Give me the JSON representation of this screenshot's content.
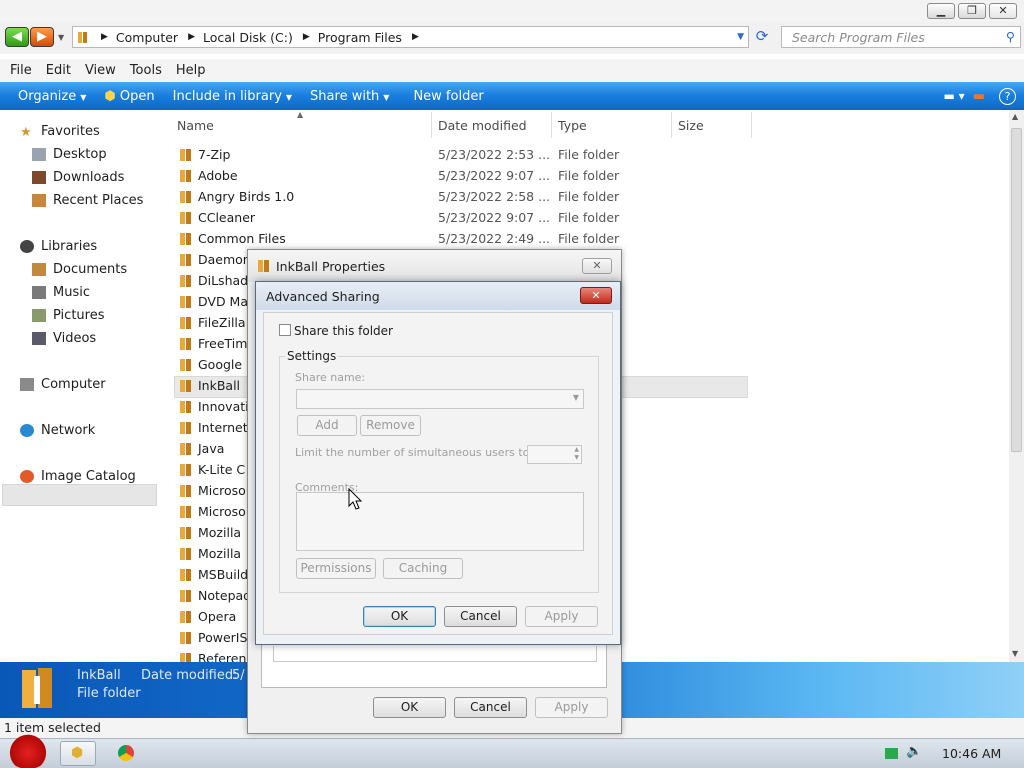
{
  "window": {
    "minimize": "▁",
    "maximize": "❐",
    "close": "✕"
  },
  "address": {
    "crumbs": [
      "Computer",
      "Local Disk (C:)",
      "Program Files"
    ],
    "search_placeholder": "Search Program Files"
  },
  "menu": [
    "File",
    "Edit",
    "View",
    "Tools",
    "Help"
  ],
  "toolbar": {
    "organize": "Organize",
    "open": "Open",
    "include_in_library": "Include in library",
    "share_with": "Share with",
    "new_folder": "New folder"
  },
  "nav": {
    "favorites": "Favorites",
    "desktop": "Desktop",
    "downloads": "Downloads",
    "recent_places": "Recent Places",
    "libraries": "Libraries",
    "documents": "Documents",
    "music": "Music",
    "pictures": "Pictures",
    "videos": "Videos",
    "computer": "Computer",
    "network": "Network",
    "image_catalog": "Image Catalog"
  },
  "columns": {
    "name": "Name",
    "date_modified": "Date modified",
    "type": "Type",
    "size": "Size"
  },
  "files": [
    {
      "name": "7-Zip",
      "date": "5/23/2022 2:53 ...",
      "type": "File folder"
    },
    {
      "name": "Adobe",
      "date": "5/23/2022 9:07 ...",
      "type": "File folder"
    },
    {
      "name": "Angry Birds 1.0",
      "date": "5/23/2022 2:58 ...",
      "type": "File folder"
    },
    {
      "name": "CCleaner",
      "date": "5/23/2022 9:07 ...",
      "type": "File folder"
    },
    {
      "name": "Common Files",
      "date": "5/23/2022 2:49 ...",
      "type": "File folder"
    },
    {
      "name": "Daemon",
      "date": "",
      "type": ""
    },
    {
      "name": "DiLshad",
      "date": "",
      "type": ""
    },
    {
      "name": "DVD Ma",
      "date": "",
      "type": ""
    },
    {
      "name": "FileZilla",
      "date": "",
      "type": ""
    },
    {
      "name": "FreeTim",
      "date": "",
      "type": ""
    },
    {
      "name": "Google",
      "date": "",
      "type": ""
    },
    {
      "name": "InkBall",
      "date": "",
      "type": ""
    },
    {
      "name": "Innovati",
      "date": "",
      "type": ""
    },
    {
      "name": "Internet",
      "date": "",
      "type": ""
    },
    {
      "name": "Java",
      "date": "",
      "type": ""
    },
    {
      "name": "K-Lite C",
      "date": "",
      "type": ""
    },
    {
      "name": "Microso",
      "date": "",
      "type": ""
    },
    {
      "name": "Microso",
      "date": "",
      "type": ""
    },
    {
      "name": "Mozilla",
      "date": "",
      "type": ""
    },
    {
      "name": "Mozilla",
      "date": "",
      "type": ""
    },
    {
      "name": "MSBuild",
      "date": "",
      "type": ""
    },
    {
      "name": "Notepad",
      "date": "",
      "type": ""
    },
    {
      "name": "Opera",
      "date": "",
      "type": ""
    },
    {
      "name": "PowerIS",
      "date": "",
      "type": ""
    },
    {
      "name": "Referen",
      "date": "",
      "type": ""
    }
  ],
  "details": {
    "name": "InkBall",
    "type": "File folder",
    "date_label": "Date modified:",
    "date_partial": "5/"
  },
  "status": "1 item selected",
  "props_dialog": {
    "title": "InkBall Properties",
    "ok": "OK",
    "cancel": "Cancel",
    "apply": "Apply"
  },
  "adv_dialog": {
    "title": "Advanced Sharing",
    "share_checkbox": "Share this folder",
    "settings": "Settings",
    "share_name": "Share name:",
    "add": "Add",
    "remove": "Remove",
    "limit": "Limit the number of simultaneous users to:",
    "comments": "Comments:",
    "permissions": "Permissions",
    "caching": "Caching",
    "ok": "OK",
    "cancel": "Cancel",
    "apply": "Apply"
  },
  "taskbar": {
    "clock": "10:46 AM"
  },
  "colors": {
    "toolbar": "#1b80e0",
    "selection": "#e8e8e8",
    "folder": "#e8a83a"
  }
}
